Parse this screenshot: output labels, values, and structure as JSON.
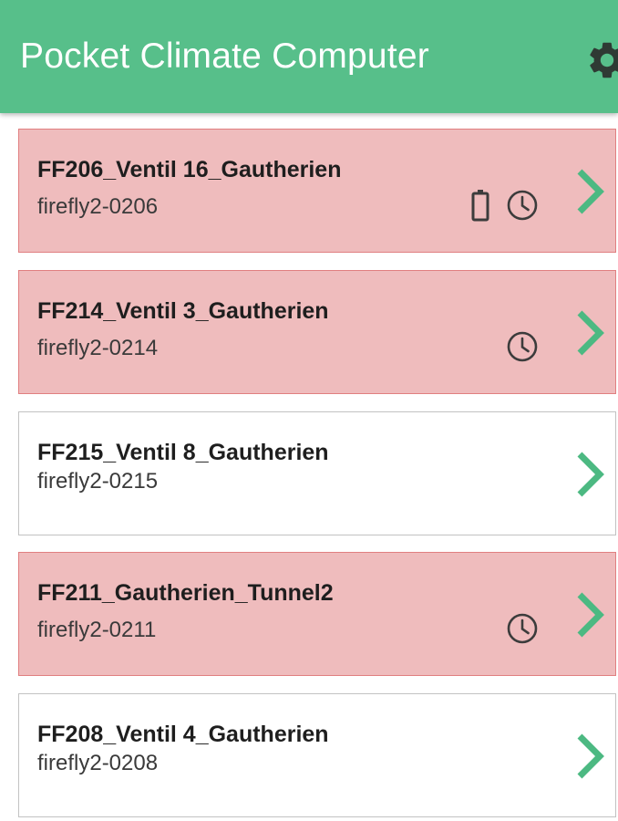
{
  "app_bar": {
    "title": "Pocket Climate Computer",
    "settings_icon": "gear-icon",
    "background_color": "#57bf8a"
  },
  "colors": {
    "alert_background": "#efbcbd",
    "alert_border": "#e07f80",
    "normal_background": "#ffffff",
    "chevron": "#4cb982",
    "status_icon": "#3c3c3c"
  },
  "devices": [
    {
      "name": "FF206_Ventil 16_Gautherien",
      "id": "firefly2-0206",
      "alert": true,
      "status_icons": [
        "battery-icon",
        "clock-icon"
      ]
    },
    {
      "name": "FF214_Ventil 3_Gautherien",
      "id": "firefly2-0214",
      "alert": true,
      "status_icons": [
        "clock-icon"
      ]
    },
    {
      "name": "FF215_Ventil 8_Gautherien",
      "id": "firefly2-0215",
      "alert": false,
      "status_icons": []
    },
    {
      "name": "FF211_Gautherien_Tunnel2",
      "id": "firefly2-0211",
      "alert": true,
      "status_icons": [
        "clock-icon"
      ]
    },
    {
      "name": "FF208_Ventil 4_Gautherien",
      "id": "firefly2-0208",
      "alert": false,
      "status_icons": []
    }
  ]
}
